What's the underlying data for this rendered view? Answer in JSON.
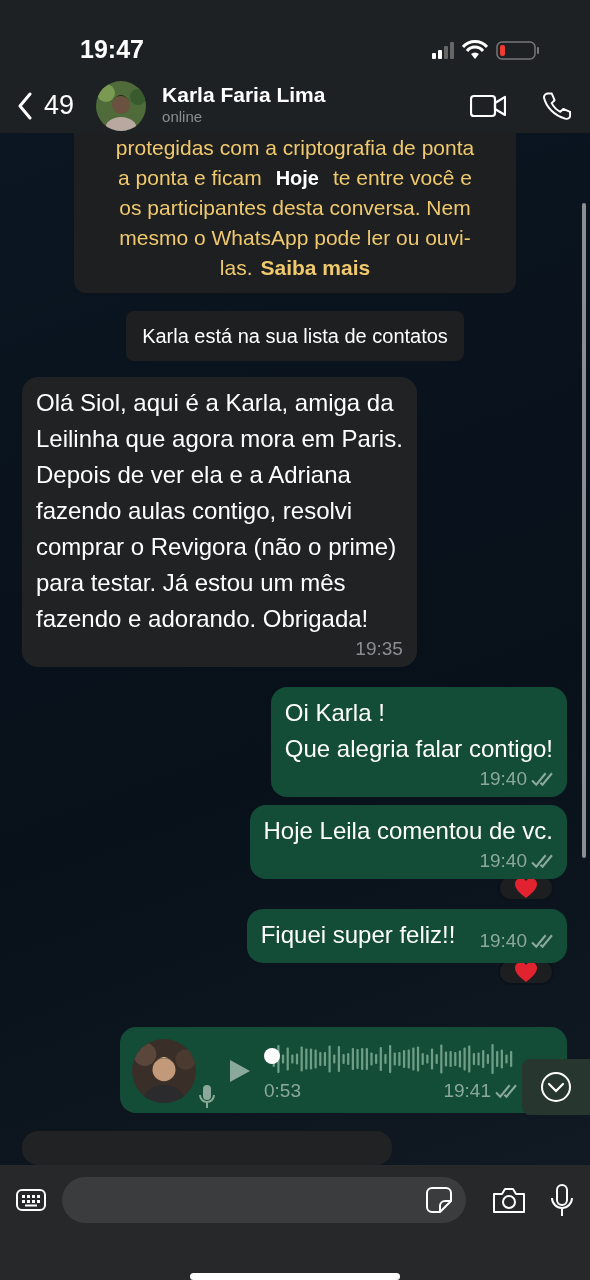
{
  "status_bar": {
    "time": "19:47"
  },
  "header": {
    "unread_count": "49",
    "contact_name": "Karla Faria Lima",
    "presence": "online"
  },
  "encryption_notice": {
    "date_badge": "Hoje",
    "lines": [
      {
        "kind": "plain",
        "text": "protegidas com a criptografia de ponta"
      },
      {
        "kind": "split",
        "left": "a ponta e ficam",
        "right": "te entre você e"
      },
      {
        "kind": "plain",
        "text": "os participantes desta conversa. Nem"
      },
      {
        "kind": "plain",
        "text": "mesmo o WhatsApp pode ler ou ouvi-"
      },
      {
        "kind": "link",
        "text": "las.",
        "link": "Saiba mais"
      }
    ]
  },
  "system_message": "Karla está na sua lista de contatos",
  "messages": [
    {
      "kind": "text",
      "outgoing": false,
      "text": "Olá Siol, aqui é a Karla, amiga da\nLeilinha que agora mora em Paris.\nDepois de ver ela e a Adriana\nfazendo aulas contigo, resolvi\ncomprar o Revigora (não o prime)\npara testar. Já estou um mês\nfazendo e adorando. Obrigada!",
      "time": "19:35",
      "reacted": false
    },
    {
      "kind": "text",
      "outgoing": true,
      "text": "Oi Karla !\nQue alegria falar contigo!",
      "time": "19:40",
      "read": false,
      "reacted": false
    },
    {
      "kind": "text",
      "outgoing": true,
      "text": "Hoje Leila comentou de vc.",
      "time": "19:40",
      "read": false,
      "reacted": true
    },
    {
      "kind": "short",
      "outgoing": true,
      "text": "Fiquei super feliz!!",
      "time": "19:40",
      "read": false,
      "reacted": true
    },
    {
      "kind": "audio",
      "outgoing": true,
      "duration": "0:53",
      "time": "19:41",
      "read": false,
      "reacted": false
    },
    {
      "kind": "hidden",
      "outgoing": false
    }
  ]
}
